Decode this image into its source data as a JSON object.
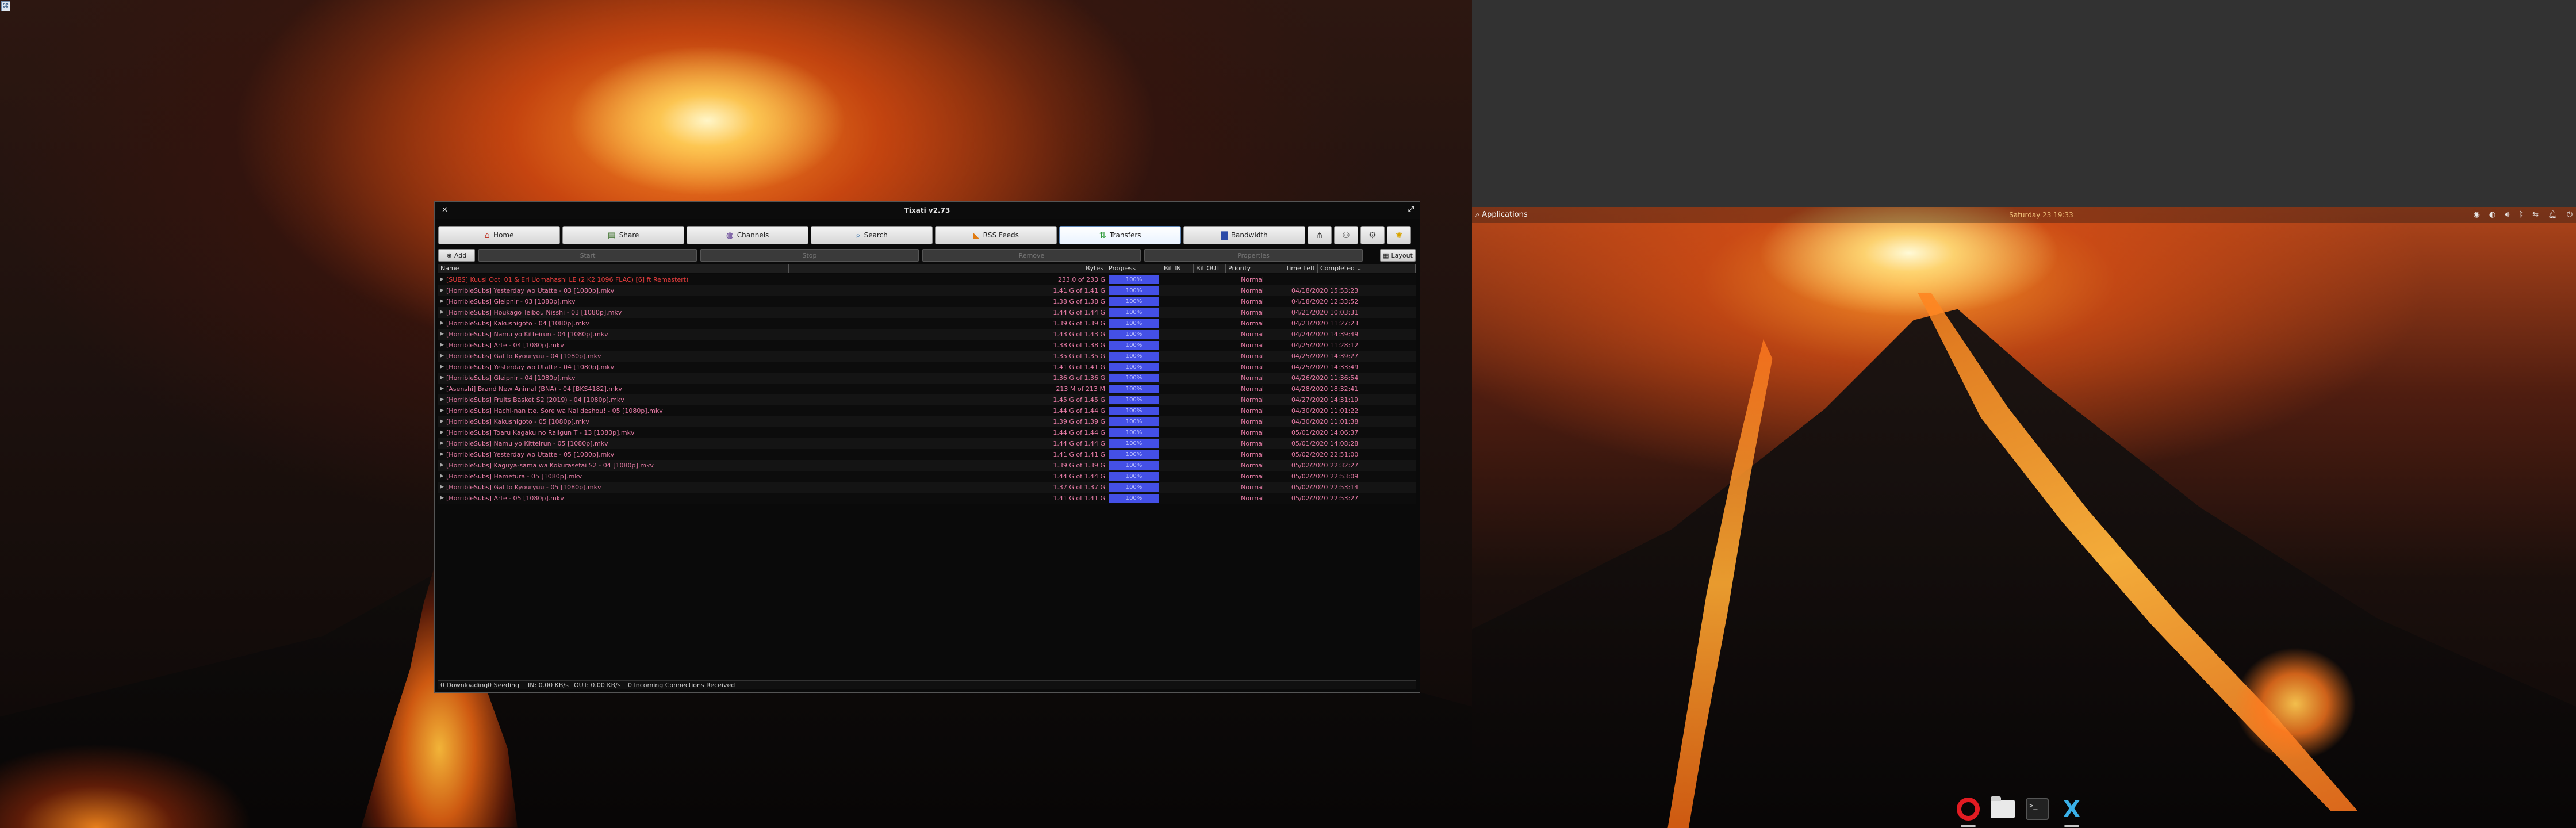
{
  "desktop": {
    "corner_icon": "⌘",
    "panel": {
      "apps_label": "Applications",
      "clock": "Saturday 23 19:33",
      "tray_icons": [
        "discord-icon",
        "steam-icon",
        "volume-icon",
        "bluetooth-icon",
        "network-icon",
        "notification-icon",
        "power-icon"
      ]
    },
    "dock": [
      "opera-icon",
      "files-icon",
      "terminal-icon",
      "tixati-icon"
    ]
  },
  "window": {
    "title": "Tixati v2.73",
    "tabs": [
      {
        "label": "Home",
        "icon": "home-icon"
      },
      {
        "label": "Share",
        "icon": "share-icon"
      },
      {
        "label": "Channels",
        "icon": "channels-icon"
      },
      {
        "label": "Search",
        "icon": "search-icon"
      },
      {
        "label": "RSS Feeds",
        "icon": "rss-icon"
      },
      {
        "label": "Transfers",
        "icon": "transfers-icon",
        "active": true
      },
      {
        "label": "Bandwidth",
        "icon": "bandwidth-icon"
      }
    ],
    "toolbar": {
      "add": "Add",
      "start": "Start",
      "stop": "Stop",
      "remove": "Remove",
      "properties": "Properties",
      "layout": "Layout"
    },
    "columns": [
      "Name",
      "Bytes",
      "Progress",
      "Bit IN",
      "Bit OUT",
      "Priority",
      "Time Left",
      "Completed"
    ],
    "rows": [
      {
        "name": "[SUBS] Kuusi Ooti 01 & Eri Uomahashi LE (2 K2 1096 FLAC) [6] ft Remastert)",
        "bytes": "233.0 of 233 G",
        "progress": 100,
        "priority": "Normal",
        "completed": ""
      },
      {
        "name": "[HorribleSubs] Yesterday wo Utatte - 03 [1080p].mkv",
        "bytes": "1.41 G of 1.41 G",
        "progress": 100,
        "priority": "Normal",
        "completed": "04/18/2020 15:53:23"
      },
      {
        "name": "[HorribleSubs] Gleipnir - 03 [1080p].mkv",
        "bytes": "1.38 G of 1.38 G",
        "progress": 100,
        "priority": "Normal",
        "completed": "04/18/2020 12:33:52"
      },
      {
        "name": "[HorribleSubs] Houkago Teibou Nisshi - 03 [1080p].mkv",
        "bytes": "1.44 G of 1.44 G",
        "progress": 100,
        "priority": "Normal",
        "completed": "04/21/2020 10:03:31"
      },
      {
        "name": "[HorribleSubs] Kakushigoto - 04 [1080p].mkv",
        "bytes": "1.39 G of 1.39 G",
        "progress": 100,
        "priority": "Normal",
        "completed": "04/23/2020 11:27:23"
      },
      {
        "name": "[HorribleSubs] Namu yo Kitteirun - 04 [1080p].mkv",
        "bytes": "1.43 G of 1.43 G",
        "progress": 100,
        "priority": "Normal",
        "completed": "04/24/2020 14:39:49"
      },
      {
        "name": "[HorribleSubs] Arte - 04 [1080p].mkv",
        "bytes": "1.38 G of 1.38 G",
        "progress": 100,
        "priority": "Normal",
        "completed": "04/25/2020 11:28:12"
      },
      {
        "name": "[HorribleSubs] Gal to Kyouryuu - 04 [1080p].mkv",
        "bytes": "1.35 G of 1.35 G",
        "progress": 100,
        "priority": "Normal",
        "completed": "04/25/2020 14:39:27"
      },
      {
        "name": "[HorribleSubs] Yesterday wo Utatte - 04 [1080p].mkv",
        "bytes": "1.41 G of 1.41 G",
        "progress": 100,
        "priority": "Normal",
        "completed": "04/25/2020 14:33:49"
      },
      {
        "name": "[HorribleSubs] Gleipnir - 04 [1080p].mkv",
        "bytes": "1.36 G of 1.36 G",
        "progress": 100,
        "priority": "Normal",
        "completed": "04/26/2020 11:36:54"
      },
      {
        "name": "[Asenshi] Brand New Animal (BNA) - 04 [BKS4182].mkv",
        "bytes": "213 M of 213 M",
        "progress": 100,
        "priority": "Normal",
        "completed": "04/28/2020 18:32:41"
      },
      {
        "name": "[HorribleSubs] Fruits Basket S2 (2019) - 04 [1080p].mkv",
        "bytes": "1.45 G of 1.45 G",
        "progress": 100,
        "priority": "Normal",
        "completed": "04/27/2020 14:31:19"
      },
      {
        "name": "[HorribleSubs] Hachi-nan tte, Sore wa Nai deshou! - 05 [1080p].mkv",
        "bytes": "1.44 G of 1.44 G",
        "progress": 100,
        "priority": "Normal",
        "completed": "04/30/2020 11:01:22"
      },
      {
        "name": "[HorribleSubs] Kakushigoto - 05 [1080p].mkv",
        "bytes": "1.39 G of 1.39 G",
        "progress": 100,
        "priority": "Normal",
        "completed": "04/30/2020 11:01:38"
      },
      {
        "name": "[HorribleSubs] Toaru Kagaku no Railgun T - 13 [1080p].mkv",
        "bytes": "1.44 G of 1.44 G",
        "progress": 100,
        "priority": "Normal",
        "completed": "05/01/2020 14:06:37"
      },
      {
        "name": "[HorribleSubs] Namu yo Kitteirun - 05 [1080p].mkv",
        "bytes": "1.44 G of 1.44 G",
        "progress": 100,
        "priority": "Normal",
        "completed": "05/01/2020 14:08:28"
      },
      {
        "name": "[HorribleSubs] Yesterday wo Utatte - 05 [1080p].mkv",
        "bytes": "1.41 G of 1.41 G",
        "progress": 100,
        "priority": "Normal",
        "completed": "05/02/2020 22:51:00"
      },
      {
        "name": "[HorribleSubs] Kaguya-sama wa Kokurasetai S2 - 04 [1080p].mkv",
        "bytes": "1.39 G of 1.39 G",
        "progress": 100,
        "priority": "Normal",
        "completed": "05/02/2020 22:32:27"
      },
      {
        "name": "[HorribleSubs] Hamefura - 05 [1080p].mkv",
        "bytes": "1.44 G of 1.44 G",
        "progress": 100,
        "priority": "Normal",
        "completed": "05/02/2020 22:53:09"
      },
      {
        "name": "[HorribleSubs] Gal to Kyouryuu - 05 [1080p].mkv",
        "bytes": "1.37 G of 1.37 G",
        "progress": 100,
        "priority": "Normal",
        "completed": "05/02/2020 22:53:14"
      },
      {
        "name": "[HorribleSubs] Arte - 05 [1080p].mkv",
        "bytes": "1.41 G of 1.41 G",
        "progress": 100,
        "priority": "Normal",
        "completed": "05/02/2020 22:53:27"
      }
    ],
    "status": {
      "downloading": "0 Downloading",
      "seeding": "0 Seeding",
      "in": "IN: 0.00 KB/s",
      "out": "OUT: 0.00 KB/s",
      "connections": "0 Incoming Connections Received"
    }
  },
  "colors": {
    "row_text": "#e57aa4",
    "first_row_text": "#e23c3c",
    "progress_fill": "#4450e6"
  }
}
